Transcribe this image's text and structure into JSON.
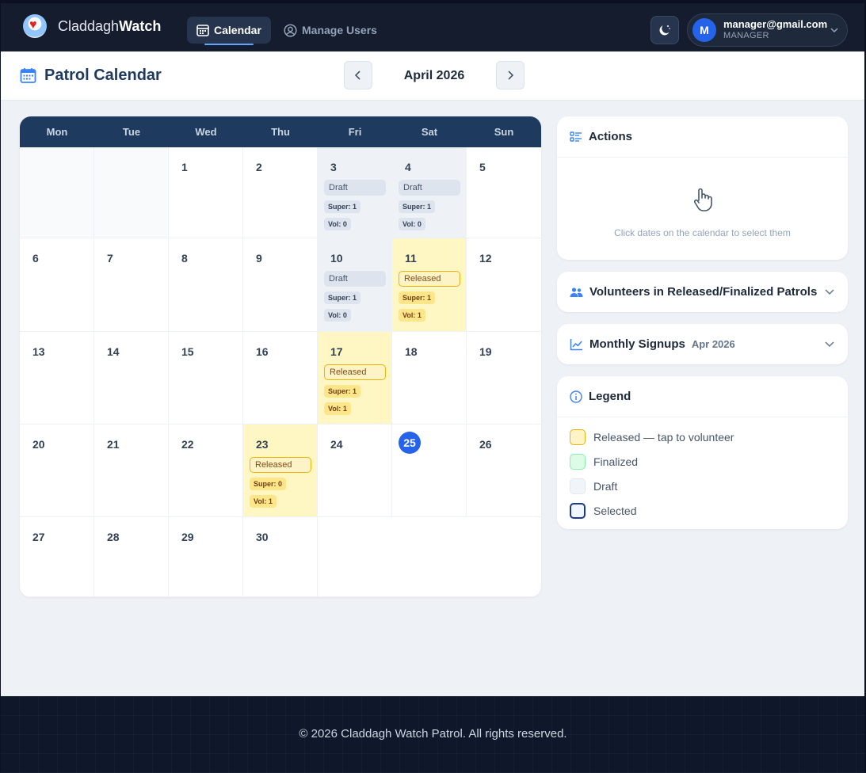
{
  "app": {
    "brand_light": "Claddagh",
    "brand_bold": "Watch",
    "nav": [
      {
        "label": "Calendar",
        "active": true
      },
      {
        "label": "Manage Users",
        "active": false
      }
    ],
    "user": {
      "initial": "M",
      "email": "manager@gmail.com",
      "role": "MANAGER"
    }
  },
  "header": {
    "title": "Patrol Calendar",
    "month": "April 2026"
  },
  "calendar": {
    "weekdays": [
      "Mon",
      "Tue",
      "Wed",
      "Thu",
      "Fri",
      "Sat",
      "Sun"
    ],
    "today": "25",
    "cells": [
      {
        "day": "",
        "state": "empty"
      },
      {
        "day": "",
        "state": "empty"
      },
      {
        "day": "1",
        "state": "normal"
      },
      {
        "day": "2",
        "state": "normal"
      },
      {
        "day": "3",
        "state": "draft",
        "status": "Draft",
        "super": "Super: 1",
        "vol": "Vol: 0"
      },
      {
        "day": "4",
        "state": "draft",
        "status": "Draft",
        "super": "Super: 1",
        "vol": "Vol: 0"
      },
      {
        "day": "5",
        "state": "normal"
      },
      {
        "day": "6",
        "state": "normal"
      },
      {
        "day": "7",
        "state": "normal"
      },
      {
        "day": "8",
        "state": "normal"
      },
      {
        "day": "9",
        "state": "normal"
      },
      {
        "day": "10",
        "state": "draft",
        "status": "Draft",
        "super": "Super: 1",
        "vol": "Vol: 0"
      },
      {
        "day": "11",
        "state": "released",
        "status": "Released",
        "super": "Super: 1",
        "vol": "Vol: 1"
      },
      {
        "day": "12",
        "state": "normal"
      },
      {
        "day": "13",
        "state": "normal"
      },
      {
        "day": "14",
        "state": "normal"
      },
      {
        "day": "15",
        "state": "normal"
      },
      {
        "day": "16",
        "state": "normal"
      },
      {
        "day": "17",
        "state": "released",
        "status": "Released",
        "super": "Super: 1",
        "vol": "Vol: 1"
      },
      {
        "day": "18",
        "state": "normal"
      },
      {
        "day": "19",
        "state": "normal"
      },
      {
        "day": "20",
        "state": "normal"
      },
      {
        "day": "21",
        "state": "normal"
      },
      {
        "day": "22",
        "state": "normal"
      },
      {
        "day": "23",
        "state": "released",
        "status": "Released",
        "super": "Super: 0",
        "vol": "Vol: 1"
      },
      {
        "day": "24",
        "state": "normal"
      },
      {
        "day": "25",
        "state": "today"
      },
      {
        "day": "26",
        "state": "normal"
      },
      {
        "day": "27",
        "state": "normal"
      },
      {
        "day": "28",
        "state": "normal"
      },
      {
        "day": "29",
        "state": "normal"
      },
      {
        "day": "30",
        "state": "normal"
      },
      {
        "day": "",
        "state": "blank"
      },
      {
        "day": "",
        "state": "blank"
      },
      {
        "day": "",
        "state": "blank"
      }
    ]
  },
  "panels": {
    "actions": {
      "title": "Actions",
      "hint": "Click dates on the calendar to select them"
    },
    "volunteers": {
      "title": "Volunteers in Released/Finalized Patrols"
    },
    "signups": {
      "title": "Monthly Signups",
      "sub": "Apr 2026"
    },
    "legend": {
      "title": "Legend",
      "items": [
        {
          "label": "Released — tap to volunteer",
          "fill": "#fef3c7",
          "border": "#eab308"
        },
        {
          "label": "Finalized",
          "fill": "#dcfce7",
          "border": "#86efac"
        },
        {
          "label": "Draft",
          "fill": "#f1f5f9",
          "border": "#e2e8f0"
        },
        {
          "label": "Selected",
          "fill": "#eff6ff",
          "border": "#1e3a8a"
        }
      ]
    }
  },
  "footer": {
    "text": "© 2026 Claddagh Watch Patrol. All rights reserved."
  }
}
